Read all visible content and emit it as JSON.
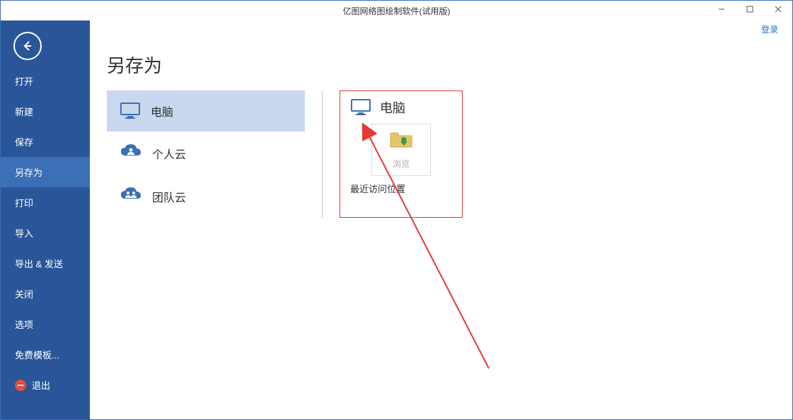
{
  "titlebar": {
    "title": "亿图网络图绘制软件(试用版)",
    "login": "登录"
  },
  "sidebar": {
    "items": [
      {
        "label": "打开",
        "id": "open"
      },
      {
        "label": "新建",
        "id": "new"
      },
      {
        "label": "保存",
        "id": "save"
      },
      {
        "label": "另存为",
        "id": "saveas",
        "active": true
      },
      {
        "label": "打印",
        "id": "print"
      },
      {
        "label": "导入",
        "id": "import"
      },
      {
        "label": "导出 & 发送",
        "id": "export"
      },
      {
        "label": "关闭",
        "id": "close"
      },
      {
        "label": "选项",
        "id": "options"
      },
      {
        "label": "免费模板...",
        "id": "templates"
      },
      {
        "label": "退出",
        "id": "exit",
        "icon": "exit"
      }
    ]
  },
  "page": {
    "title": "另存为"
  },
  "locations": {
    "items": [
      {
        "label": "电脑",
        "icon": "monitor",
        "selected": true
      },
      {
        "label": "个人云",
        "icon": "cloud-user"
      },
      {
        "label": "团队云",
        "icon": "cloud-team"
      }
    ]
  },
  "detail": {
    "title": "电脑",
    "browse_label": "浏览",
    "recent_label": "最近访问位置"
  }
}
